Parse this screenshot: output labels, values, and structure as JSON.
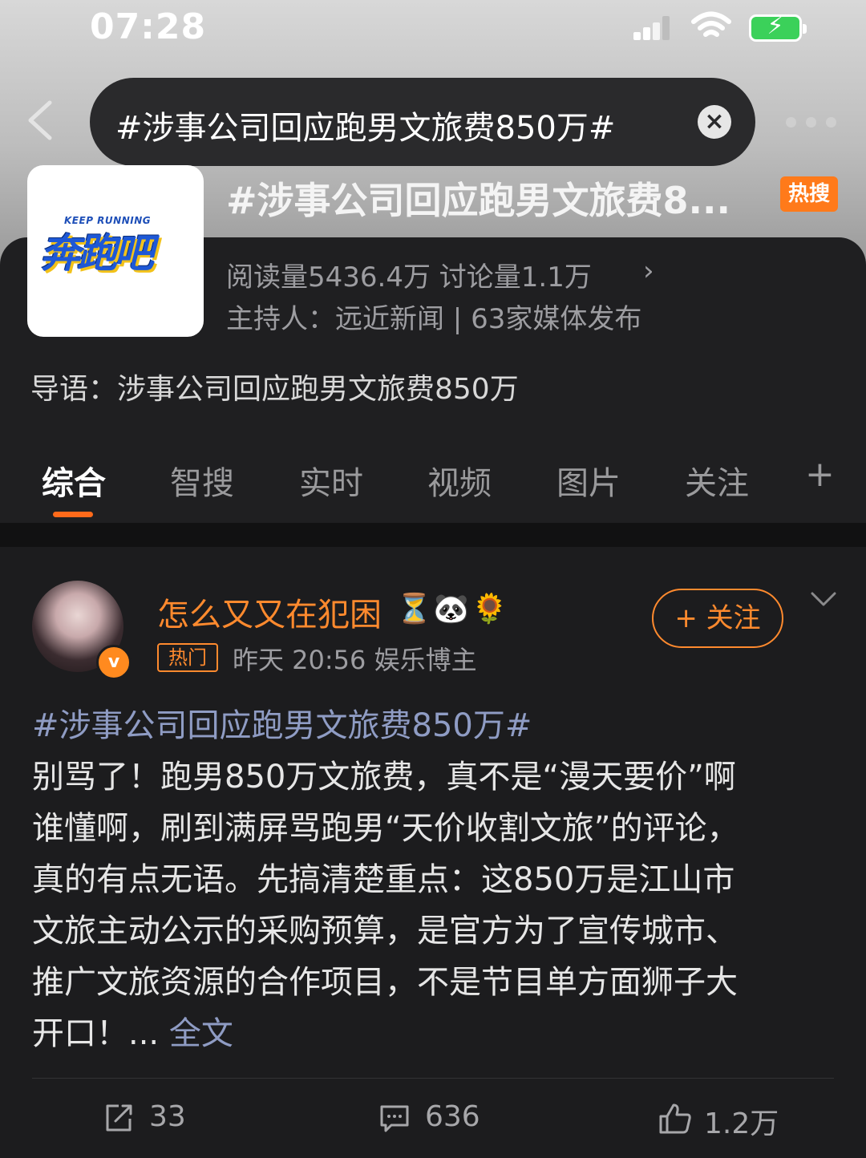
{
  "status_bar": {
    "time": "07:28"
  },
  "search": {
    "query": "#涉事公司回应跑男文旅费850万#"
  },
  "topic": {
    "logo_text": "奔跑吧",
    "logo_small": "KEEP RUNNING",
    "title": "#涉事公司回应跑男文旅费8...",
    "badge": "热搜",
    "stats": "阅读量5436.4万  讨论量1.1万",
    "host": "主持人：远近新闻 | 63家媒体发布",
    "intro": "导语：涉事公司回应跑男文旅费850万"
  },
  "tabs": [
    "综合",
    "智搜",
    "实时",
    "视频",
    "图片",
    "关注"
  ],
  "post": {
    "username": "怎么又又在犯困",
    "emojis": [
      "⏳",
      "🐼",
      "🌻"
    ],
    "hot_tag": "热门",
    "meta": "昨天 20:56  娱乐博主",
    "follow_label": "+ 关注",
    "hashtag": "#涉事公司回应跑男文旅费850万#",
    "lines": [
      "别骂了！跑男850万文旅费，真不是“漫天要价”啊",
      "谁懂啊，刷到满屏骂跑男“天价收割文旅”的评论，",
      "真的有点无语。先搞清楚重点：这850万是江山市",
      "文旅主动公示的采购预算，是官方为了宣传城市、",
      "推广文旅资源的合作项目，不是节目单方面狮子大",
      "开口！..."
    ],
    "full_text": "全文",
    "repost_count": "33",
    "comment_count": "636",
    "like_count": "1.2万"
  }
}
